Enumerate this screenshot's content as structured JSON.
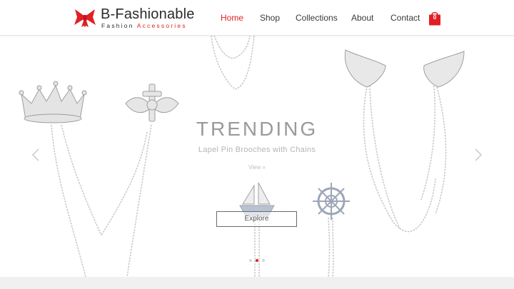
{
  "brand": {
    "name": "B-Fashionable",
    "tagline_part1": "Fashion",
    "tagline_part2": "Accessories",
    "accent_color": "#e11f26",
    "logo_icon": "red-bow-icon"
  },
  "nav": {
    "items": [
      {
        "label": "Home",
        "active": true
      },
      {
        "label": "Shop",
        "active": false
      },
      {
        "label": "Collections",
        "active": false
      },
      {
        "label": "About",
        "active": false
      },
      {
        "label": "Contact",
        "active": false
      }
    ],
    "cart": {
      "icon": "shopping-bag-icon",
      "count": "0"
    }
  },
  "hero": {
    "title": "TRENDING",
    "subtitle": "Lapel Pin Brooches with Chains",
    "link_text": "View »",
    "button_label": "Explore",
    "prev_icon": "chevron-left-icon",
    "next_icon": "chevron-right-icon",
    "slides_total": 3,
    "active_slide": 2
  }
}
